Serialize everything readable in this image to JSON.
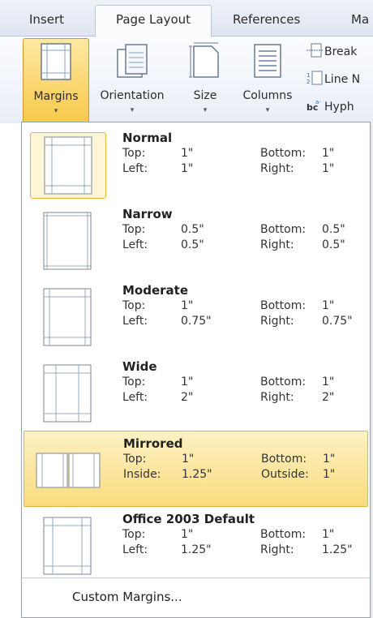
{
  "tabs": [
    "Insert",
    "Page Layout",
    "References",
    "Ma"
  ],
  "ribbon": {
    "margins": "Margins",
    "orientation": "Orientation",
    "size": "Size",
    "columns": "Columns",
    "breaks": "Break",
    "line_numbers": "Line N",
    "hyphenation": "Hyph"
  },
  "margin_presets": [
    {
      "name": "Normal",
      "label_a": "Top:",
      "val_a": "1\"",
      "label_b": "Bottom:",
      "val_b": "1\"",
      "label_c": "Left:",
      "val_c": "1\"",
      "label_d": "Right:",
      "val_d": "1\""
    },
    {
      "name": "Narrow",
      "label_a": "Top:",
      "val_a": "0.5\"",
      "label_b": "Bottom:",
      "val_b": "0.5\"",
      "label_c": "Left:",
      "val_c": "0.5\"",
      "label_d": "Right:",
      "val_d": "0.5\""
    },
    {
      "name": "Moderate",
      "label_a": "Top:",
      "val_a": "1\"",
      "label_b": "Bottom:",
      "val_b": "1\"",
      "label_c": "Left:",
      "val_c": "0.75\"",
      "label_d": "Right:",
      "val_d": "0.75\""
    },
    {
      "name": "Wide",
      "label_a": "Top:",
      "val_a": "1\"",
      "label_b": "Bottom:",
      "val_b": "1\"",
      "label_c": "Left:",
      "val_c": "2\"",
      "label_d": "Right:",
      "val_d": "2\""
    },
    {
      "name": "Mirrored",
      "label_a": "Top:",
      "val_a": "1\"",
      "label_b": "Bottom:",
      "val_b": "1\"",
      "label_c": "Inside:",
      "val_c": "1.25\"",
      "label_d": "Outside:",
      "val_d": "1\""
    },
    {
      "name": "Office 2003 Default",
      "label_a": "Top:",
      "val_a": "1\"",
      "label_b": "Bottom:",
      "val_b": "1\"",
      "label_c": "Left:",
      "val_c": "1.25\"",
      "label_d": "Right:",
      "val_d": "1.25\""
    }
  ],
  "custom_margins": "Custom Margins...",
  "colors": {
    "highlight": "#f9dc7e",
    "accent_border": "#e2b440"
  }
}
